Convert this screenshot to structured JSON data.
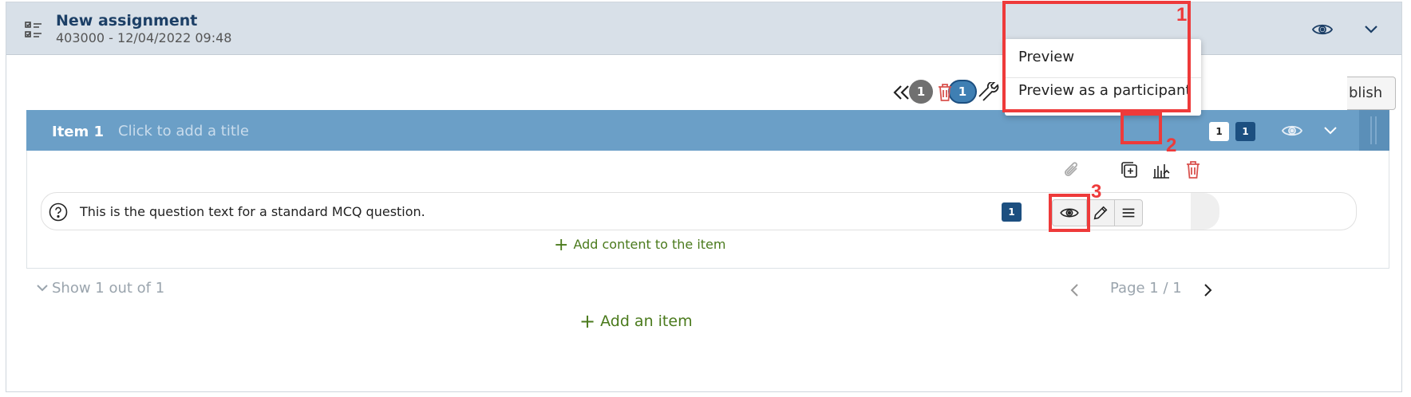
{
  "header": {
    "title": "New assignment",
    "subtitle": "403000 - 12/04/2022 09:48",
    "icon": "checklist-icon"
  },
  "toolbar": {
    "count_grey": "1",
    "count_blue": "1",
    "publish_label": "blish"
  },
  "dropdown": {
    "items": [
      "Preview",
      "Preview as a participant"
    ]
  },
  "item": {
    "label": "Item 1",
    "title_placeholder": "Click to add a title",
    "badge_white": "1",
    "badge_dark": "1",
    "question": {
      "text": "This is the question text for a standard MCQ question.",
      "badge": "1"
    },
    "add_content": "Add content to the item"
  },
  "footer": {
    "show": "Show 1 out of 1",
    "page": "Page 1 / 1",
    "add_item": "Add an item"
  },
  "annotations": [
    "1",
    "2",
    "3"
  ],
  "colors": {
    "accent": "#6b9fc7",
    "dark_blue": "#1c4f80",
    "highlight": "#ee3a3a",
    "add_green": "#4a7a1c",
    "delete_red": "#d9534f"
  }
}
